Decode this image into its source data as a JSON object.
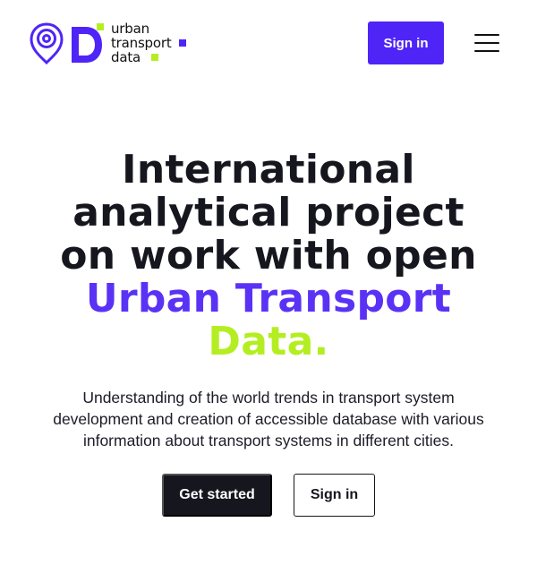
{
  "brand": {
    "line1": "urban",
    "line2": "transport",
    "line3": "data",
    "colors": {
      "primary": "#4f25f7",
      "accent": "#b4ee22",
      "dark": "#16161f"
    }
  },
  "header": {
    "signin_label": "Sign in",
    "menu_icon": "hamburger-icon"
  },
  "hero": {
    "title_line1": "International",
    "title_line2": "analytical project",
    "title_line3": "on work with open",
    "title_line4": "Urban Transport",
    "title_line5": "Data.",
    "desc_line1": "Understanding of the world trends in transport system",
    "desc_line2": "development and creation of accessible database with various",
    "desc_line3": "information about transport systems in different cities.",
    "cta_primary": "Get started",
    "cta_secondary": "Sign in"
  }
}
